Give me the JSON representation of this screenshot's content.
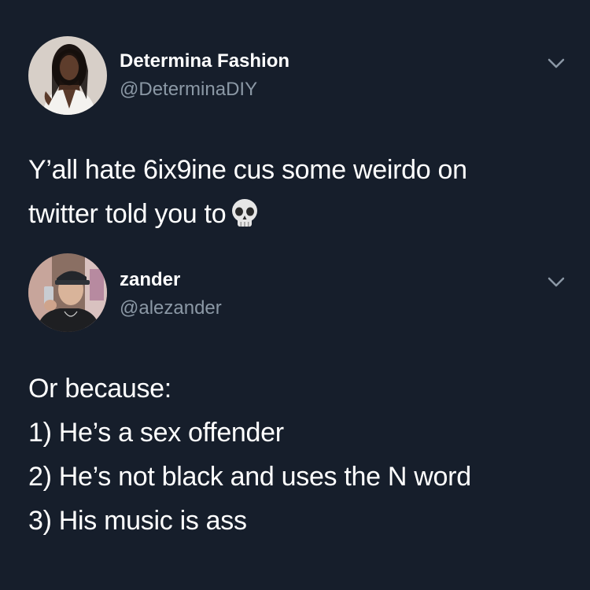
{
  "tweet1": {
    "author_name": "Determina Fashion",
    "author_handle": "@DeterminaDIY",
    "avatar_icon": "avatar-photo-woman",
    "text_lines": [
      "Y’all hate 6ix9ine cus some weirdo on",
      "twitter told you to"
    ],
    "emoji": "skull-icon"
  },
  "tweet2": {
    "author_name": "zander",
    "author_handle": "@alezander",
    "avatar_icon": "avatar-photo-man",
    "text_lines": [
      "Or because:",
      "1) He’s a sex offender",
      "2) He’s not black and uses the N word",
      "3) His music is ass"
    ]
  },
  "theme": {
    "background": "#161e2b",
    "text": "#ffffff",
    "secondary_text": "#8b98a5"
  }
}
